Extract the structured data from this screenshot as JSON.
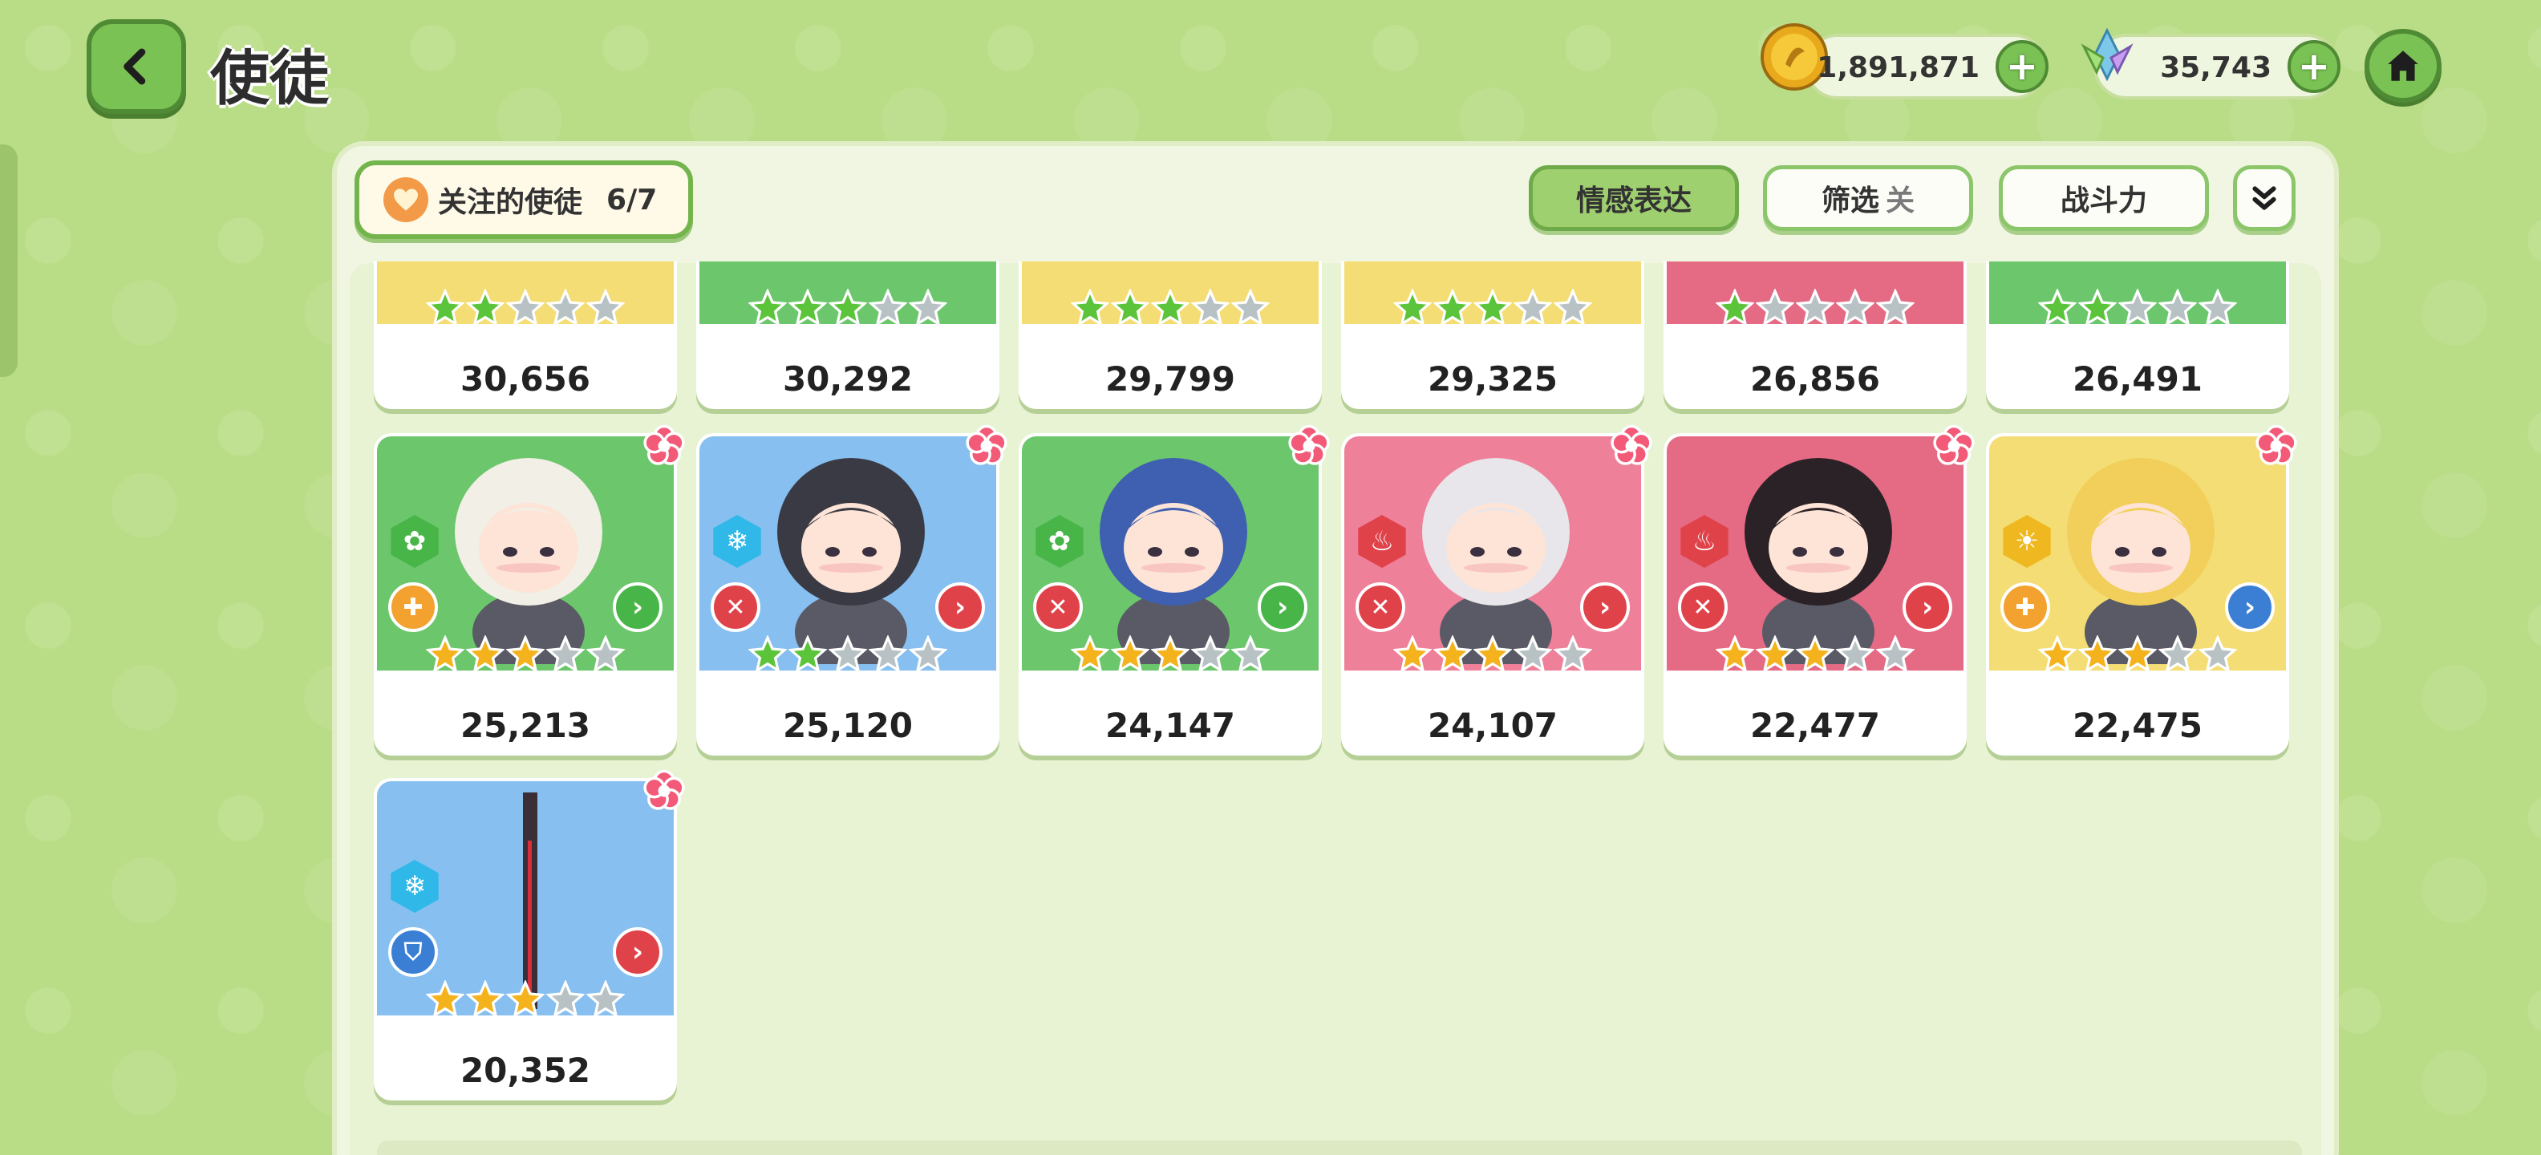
{
  "header": {
    "title": "使徒",
    "back_icon": "chevron-left-icon",
    "home_icon": "home-icon"
  },
  "currencies": [
    {
      "name": "gold",
      "icon": "gold-coin-icon",
      "value": "1,891,871"
    },
    {
      "name": "crystal",
      "icon": "crystal-flower-icon",
      "value": "35,743"
    }
  ],
  "toolbar": {
    "favorite_label": "关注的使徒",
    "favorite_count": "6/7",
    "emotion_label": "情感表达",
    "filter_label": "筛选",
    "filter_state": "关",
    "power_label": "战斗力"
  },
  "colors": {
    "accent_green": "#7bc255",
    "panel_bg": "#f1f6e3",
    "page_bg": "#b9dc86"
  },
  "top_row_powers": [
    "30,656",
    "30,292",
    "29,799",
    "29,325",
    "26,856",
    "26,491"
  ],
  "top_row_stars": [
    2,
    3,
    3,
    3,
    1,
    2
  ],
  "characters": [
    {
      "power": "25,213",
      "stars": 3,
      "star_color": "gold",
      "bg": "green",
      "element": "leaf",
      "role": "cross",
      "arrow": "green"
    },
    {
      "power": "25,120",
      "stars": 2,
      "star_color": "green",
      "bg": "blue",
      "element": "ice",
      "role": "sword",
      "arrow": "red"
    },
    {
      "power": "24,147",
      "stars": 3,
      "star_color": "gold",
      "bg": "green",
      "element": "leaf",
      "role": "sword",
      "arrow": "green"
    },
    {
      "power": "24,107",
      "stars": 3,
      "star_color": "gold",
      "bg": "pink",
      "element": "fire",
      "role": "sword",
      "arrow": "red"
    },
    {
      "power": "22,477",
      "stars": 3,
      "star_color": "gold",
      "bg": "red",
      "element": "fire",
      "role": "sword",
      "arrow": "red"
    },
    {
      "power": "22,475",
      "stars": 3,
      "star_color": "gold",
      "bg": "yellow",
      "element": "light",
      "role": "cross",
      "arrow": "blue"
    },
    {
      "power": "20,352",
      "stars": 3,
      "star_color": "gold",
      "bg": "blue",
      "element": "ice",
      "role": "shield",
      "arrow": "red"
    }
  ]
}
